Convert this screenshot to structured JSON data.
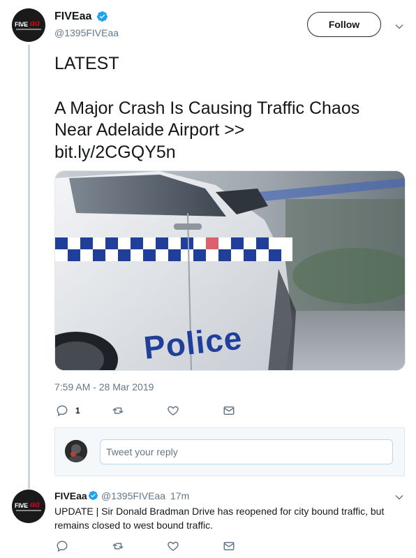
{
  "main_tweet": {
    "author_name": "FIVEaa",
    "author_handle": "@1395FIVEaa",
    "follow_label": "Follow",
    "text_line1": "LATEST",
    "text_line2": "A Major Crash Is Causing Traffic Chaos",
    "text_line3": "Near Adelaide Airport >>",
    "link": "bit.ly/2CGQY5n",
    "photo_text": "Police",
    "timestamp": "7:59 AM - 28 Mar 2019",
    "reply_count": "1",
    "icons": [
      "reply-icon",
      "retweet-icon",
      "like-icon",
      "direct-message-icon"
    ]
  },
  "reply_composer": {
    "placeholder": "Tweet your reply"
  },
  "reply_tweet": {
    "author_name": "FIVEaa",
    "author_handle": "@1395FIVEaa",
    "separator": "·",
    "time": "17m",
    "text": "UPDATE | Sir Donald Bradman Drive has reopened for city bound traffic, but remains closed to west bound traffic."
  },
  "logo": {
    "five": "FIVE",
    "aa": "aa"
  },
  "colors": {
    "verified_blue": "#1da1f2",
    "text_primary": "#14171a",
    "text_secondary": "#657786",
    "brand_red": "#d0021b"
  }
}
